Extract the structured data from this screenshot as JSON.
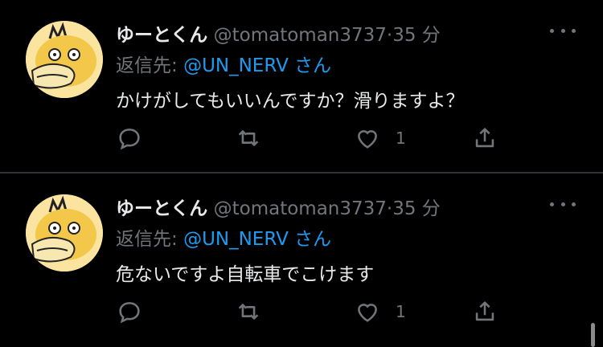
{
  "tweets": [
    {
      "name": "ゆーとくん",
      "handle": "@tomatoman3737",
      "separator": "·",
      "time": "35 分",
      "reply_prefix": "返信先: ",
      "reply_mention": "@UN_NERV",
      "reply_suffix": " さん",
      "text": "かけがしてもいいんですか？滑りますよ？",
      "like_count": "1"
    },
    {
      "name": "ゆーとくん",
      "handle": "@tomatoman3737",
      "separator": "·",
      "time": "35 分",
      "reply_prefix": "返信先: ",
      "reply_mention": "@UN_NERV",
      "reply_suffix": " さん",
      "text": "危ないですよ自転車でこけます",
      "like_count": "1"
    }
  ],
  "icons": {
    "avatar": "psyduck-avatar",
    "more": "more-dots-icon",
    "reply": "reply-icon",
    "retweet": "retweet-icon",
    "like": "heart-icon",
    "share": "share-icon"
  },
  "colors": {
    "background": "#000000",
    "text": "#e7e9ea",
    "muted": "#71767b",
    "mention": "#1d9bf0"
  }
}
